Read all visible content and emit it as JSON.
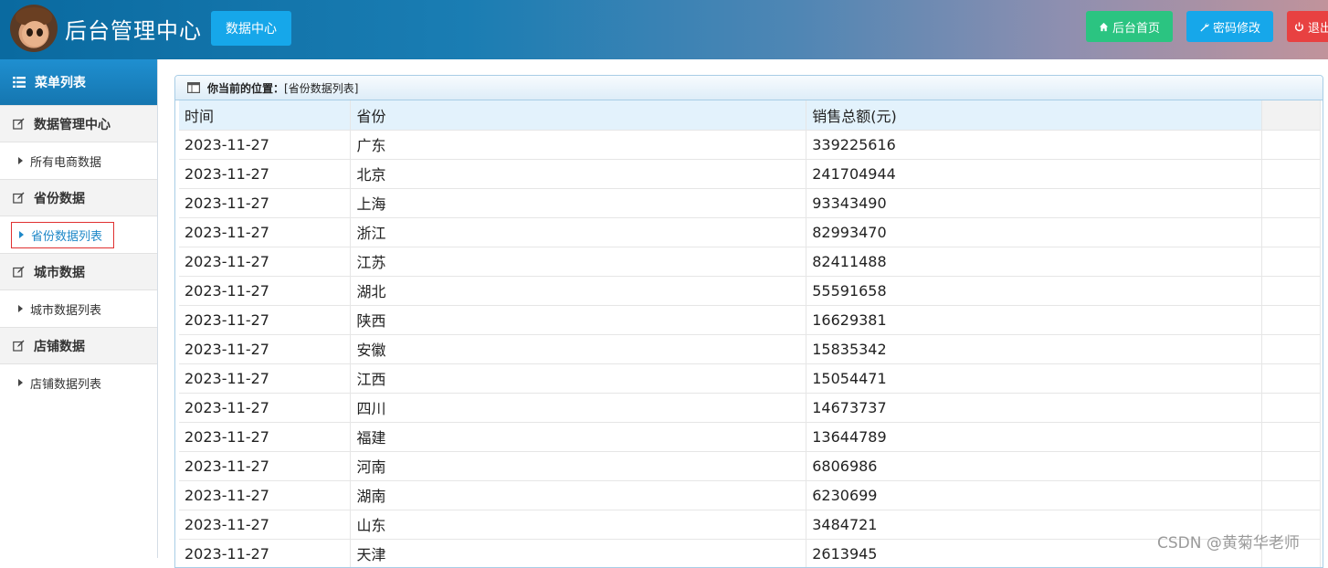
{
  "header": {
    "app_title": "后台管理中心",
    "data_center_label": "数据中心",
    "home_label": "后台首页",
    "password_label": "密码修改",
    "logout_label": "退出"
  },
  "sidebar": {
    "menu_title": "菜单列表",
    "groups": [
      {
        "label": "数据管理中心",
        "items": [
          {
            "label": "所有电商数据"
          }
        ]
      },
      {
        "label": "省份数据",
        "items": [
          {
            "label": "省份数据列表"
          }
        ]
      },
      {
        "label": "城市数据",
        "items": [
          {
            "label": "城市数据列表"
          }
        ]
      },
      {
        "label": "店铺数据",
        "items": [
          {
            "label": "店铺数据列表"
          }
        ]
      }
    ]
  },
  "breadcrumb": {
    "prefix": "你当前的位置：",
    "path": "[省份数据列表]"
  },
  "table": {
    "headers": [
      "时间",
      "省份",
      "销售总额(元)",
      ""
    ],
    "rows": [
      [
        "2023-11-27",
        "广东",
        "339225616"
      ],
      [
        "2023-11-27",
        "北京",
        "241704944"
      ],
      [
        "2023-11-27",
        "上海",
        "93343490"
      ],
      [
        "2023-11-27",
        "浙江",
        "82993470"
      ],
      [
        "2023-11-27",
        "江苏",
        "82411488"
      ],
      [
        "2023-11-27",
        "湖北",
        "55591658"
      ],
      [
        "2023-11-27",
        "陕西",
        "16629381"
      ],
      [
        "2023-11-27",
        "安徽",
        "15835342"
      ],
      [
        "2023-11-27",
        "江西",
        "15054471"
      ],
      [
        "2023-11-27",
        "四川",
        "14673737"
      ],
      [
        "2023-11-27",
        "福建",
        "13644789"
      ],
      [
        "2023-11-27",
        "河南",
        "6806986"
      ],
      [
        "2023-11-27",
        "湖南",
        "6230699"
      ],
      [
        "2023-11-27",
        "山东",
        "3484721"
      ],
      [
        "2023-11-27",
        "天津",
        "2613945"
      ]
    ]
  },
  "watermark": "CSDN @黄菊华老师"
}
